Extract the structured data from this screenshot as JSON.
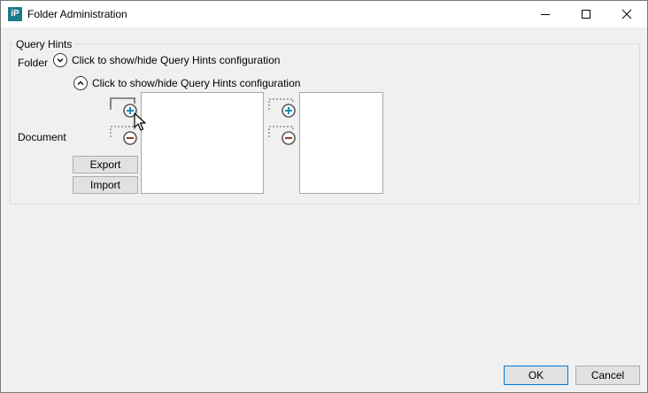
{
  "window": {
    "title": "Folder Administration",
    "app_icon_text": "iP",
    "app_icon_color": "#1f7a8c"
  },
  "query_hints": {
    "group_label": "Query Hints",
    "folder_label": "Folder",
    "folder_toggle_label": "Click to show/hide Query Hints configuration",
    "document_toggle_label": "Click to show/hide Query Hints configuration",
    "document_label": "Document",
    "export_label": "Export",
    "import_label": "Import",
    "left_list_items": [],
    "right_list_items": []
  },
  "footer": {
    "ok_label": "OK",
    "cancel_label": "Cancel"
  },
  "icons": [
    "add-icon",
    "remove-icon",
    "chevron-down-icon",
    "chevron-up-icon",
    "minimize-icon",
    "maximize-icon",
    "close-icon",
    "mouse-cursor-icon"
  ],
  "colors": {
    "accent_plus": "#1a8cb0",
    "accent_minus": "#9a3b2a",
    "ok_border": "#0078d7"
  }
}
